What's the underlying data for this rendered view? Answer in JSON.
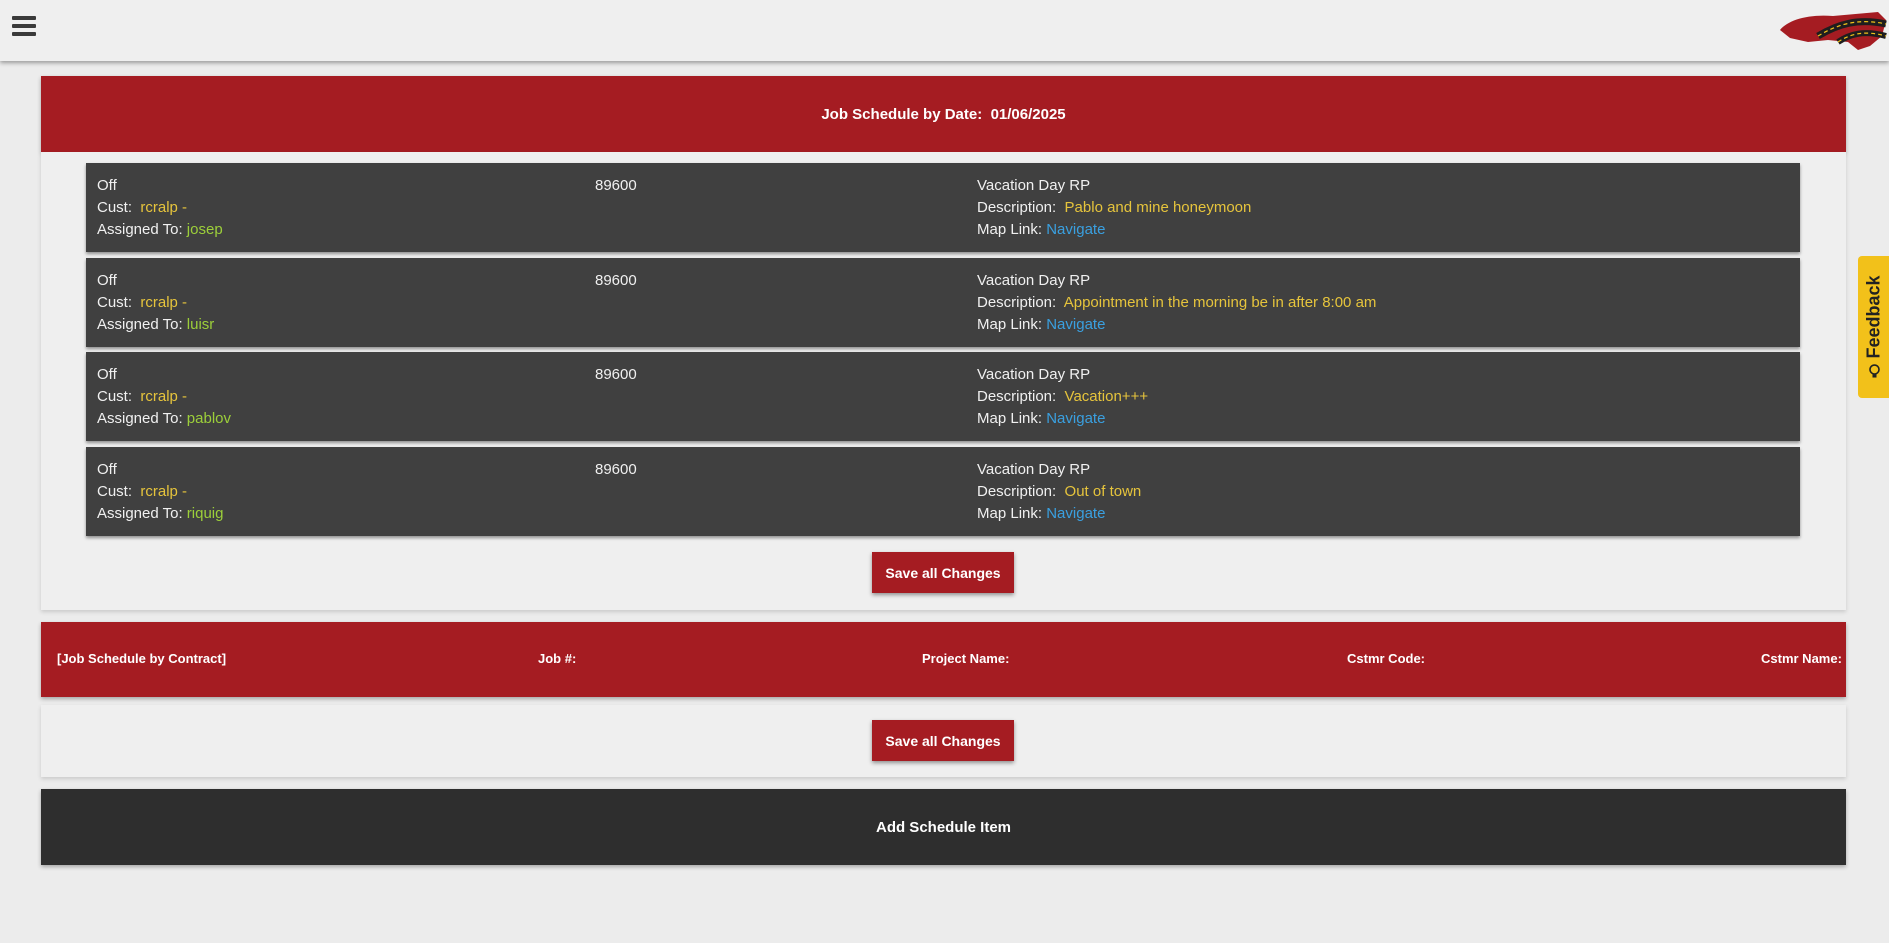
{
  "header": {
    "menu_icon": "hamburger-icon",
    "logo_icon": "road-logo-icon"
  },
  "schedule": {
    "title_label": "Job Schedule by Date:",
    "date": "01/06/2025",
    "items": [
      {
        "status": "Off",
        "cust_label": "Cust:",
        "cust": "rcralp -",
        "assigned_label": "Assigned To:",
        "assigned": "josep",
        "job_number": "89600",
        "title": "Vacation Day RP",
        "description_label": "Description:",
        "description": "Pablo and mine honeymoon",
        "map_label": "Map Link:",
        "map_link": "Navigate"
      },
      {
        "status": "Off",
        "cust_label": "Cust:",
        "cust": "rcralp -",
        "assigned_label": "Assigned To:",
        "assigned": "luisr",
        "job_number": "89600",
        "title": "Vacation Day RP",
        "description_label": "Description:",
        "description": "Appointment in the morning be in after 8:00 am",
        "map_label": "Map Link:",
        "map_link": "Navigate"
      },
      {
        "status": "Off",
        "cust_label": "Cust:",
        "cust": "rcralp -",
        "assigned_label": "Assigned To:",
        "assigned": "pablov",
        "job_number": "89600",
        "title": "Vacation Day RP",
        "description_label": "Description:",
        "description": "Vacation+++",
        "map_label": "Map Link:",
        "map_link": "Navigate"
      },
      {
        "status": "Off",
        "cust_label": "Cust:",
        "cust": "rcralp -",
        "assigned_label": "Assigned To:",
        "assigned": "riquig",
        "job_number": "89600",
        "title": "Vacation Day RP",
        "description_label": "Description:",
        "description": "Out of town",
        "map_label": "Map Link:",
        "map_link": "Navigate"
      }
    ],
    "save_label": "Save all Changes"
  },
  "contract": {
    "title": "[Job Schedule by Contract]",
    "job_label": "Job #:",
    "project_label": "Project Name:",
    "cstmr_code_label": "Cstmr Code:",
    "cstmr_name_label": "Cstmr Name:",
    "save_label": "Save all Changes"
  },
  "add_item_label": "Add Schedule Item",
  "feedback": {
    "label": "Feedback",
    "icon": "lightbulb-icon"
  },
  "colors": {
    "accent_red": "#a51c22",
    "dark_card": "#404040",
    "yellow_text": "#e6c43c",
    "green_text": "#9ccf3a",
    "link_blue": "#3aa0e0",
    "feedback_yellow": "#f2c11a"
  }
}
